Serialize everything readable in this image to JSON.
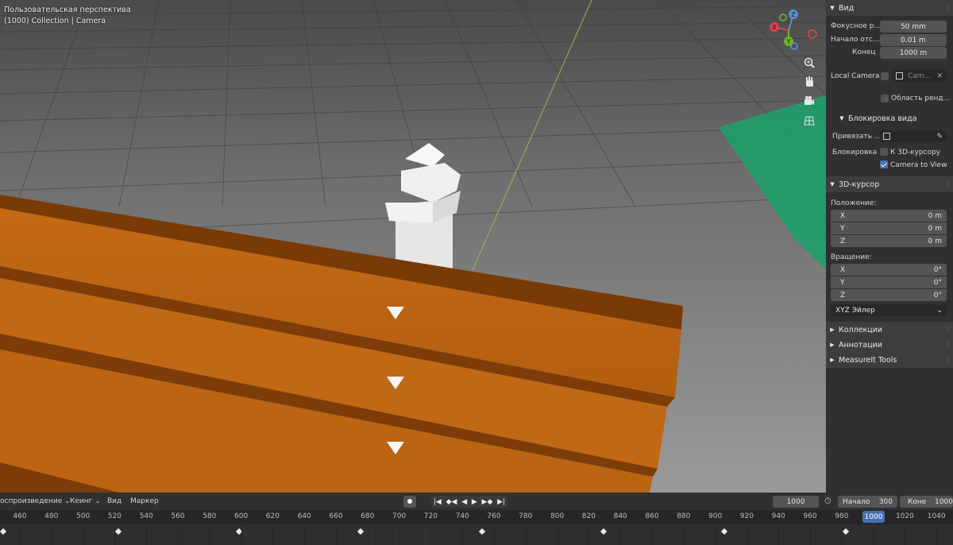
{
  "viewport": {
    "title": "Пользовательская перспектива",
    "subtitle": "(1000) Collection | Camera",
    "gizmo": {
      "z": "Z",
      "y": "Y",
      "x": "X"
    },
    "icons": [
      "zoom-icon",
      "hand-pan-icon",
      "camera-view-icon",
      "grid-ortho-icon"
    ]
  },
  "sidebar": {
    "view_panel": {
      "title": "Вид",
      "focal_label": "Фокусное р...",
      "focal_value": "50 mm",
      "clip_start_label": "Начало отс...",
      "clip_start_value": "0.01 m",
      "clip_end_label": "Конец",
      "clip_end_value": "1000 m",
      "local_camera_label": "Local Camera",
      "local_camera_value": "Cam...",
      "render_region_label": "Область ренд...",
      "view_lock_title": "Блокировка вида",
      "lock_to_object_label": "Привязать ...",
      "lock_label": "Блокировка",
      "lock_to_cursor_label": "К 3D-курсору",
      "camera_to_view_label": "Camera to View"
    },
    "cursor_panel": {
      "title": "3D-курсор",
      "location_label": "Положение:",
      "location": [
        {
          "axis": "X",
          "value": "0 m"
        },
        {
          "axis": "Y",
          "value": "0 m"
        },
        {
          "axis": "Z",
          "value": "0 m"
        }
      ],
      "rotation_label": "Вращение:",
      "rotation": [
        {
          "axis": "X",
          "value": "0°"
        },
        {
          "axis": "Y",
          "value": "0°"
        },
        {
          "axis": "Z",
          "value": "0°"
        }
      ],
      "rotation_mode": "XYZ Эйлер"
    },
    "collapsed_panels": [
      "Коллекции",
      "Аннотации",
      "MeasureIt Tools"
    ]
  },
  "timeline": {
    "playback": "Воспроизведение",
    "keying": "Кеинг",
    "view": "Вид",
    "marker": "Маркер",
    "current_frame": "1000",
    "start_label": "Начало",
    "start_value": "300",
    "end_label": "Коне",
    "end_value": "1000",
    "ruler": [
      "460",
      "480",
      "500",
      "520",
      "540",
      "560",
      "580",
      "600",
      "620",
      "640",
      "660",
      "680",
      "700",
      "720",
      "740",
      "760",
      "780",
      "800",
      "820",
      "840",
      "860",
      "880",
      "900",
      "920",
      "940",
      "960",
      "980",
      "1000",
      "1020",
      "1040"
    ],
    "keyframes": [
      445,
      522,
      598,
      675,
      752,
      829,
      905,
      982
    ]
  }
}
